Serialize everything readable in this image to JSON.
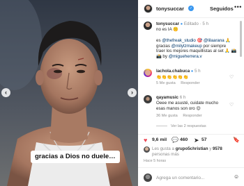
{
  "media": {
    "caption": "gracias a Dios no duele…",
    "prev_icon": "‹",
    "next_icon": "›"
  },
  "header": {
    "username": "tonysuccar",
    "verified_icon": "✓",
    "follow_label": "Seguidos",
    "more_icon": "•••"
  },
  "caption_post": {
    "username": "tonysuccar",
    "edited": "Editado",
    "time": "5 h",
    "line1": "no es IA 🤫",
    "line2_a": "es ",
    "mention1": "@thefreak_studio",
    "line2_b": " 🎯",
    "mention2": "@lilaarana",
    "line2_c": " 🙏",
    "line3_a": "gracias ",
    "mention3": "@milytzmakeup",
    "line3_b": " por siempre",
    "line4": "traer los mejores maquillistas al set 🙏 📸",
    "line5_a": "📸 by ",
    "mention4": "@migueherrera.v"
  },
  "comments": [
    {
      "username": "lachola.chabuca",
      "verified": true,
      "time": "5 h",
      "text": "👏👏👏👏👏👏",
      "likes": "5 Me gusta",
      "reply": "Responder"
    },
    {
      "username": "qayamusic",
      "time": "6 h",
      "text1": "Oeee me asusté, cuidate mucho",
      "text2": "esas manos son oro 😌",
      "likes": "36 Me gusta",
      "reply": "Responder",
      "view_replies": "Ver las 2 respuestas"
    }
  ],
  "actions": {
    "like_icon": "♥",
    "like_count": "9,6 mil",
    "comment_icon": "💬",
    "comment_count": "460",
    "share_icon": "➤",
    "share_count": "57",
    "save_icon": "🔖"
  },
  "likes_summary": {
    "prefix": "Les gusta a ",
    "user": "grupo5christian",
    "middle": " y ",
    "count": "9578",
    "suffix": "personas más"
  },
  "time_ago": "Hace 5 horas",
  "composer": {
    "placeholder": "Agrega un comentario...",
    "emoji_icon": "☺"
  },
  "colors": {
    "link": "#00376b",
    "verified": "#3897f0",
    "heart_like": "#ed4956"
  }
}
